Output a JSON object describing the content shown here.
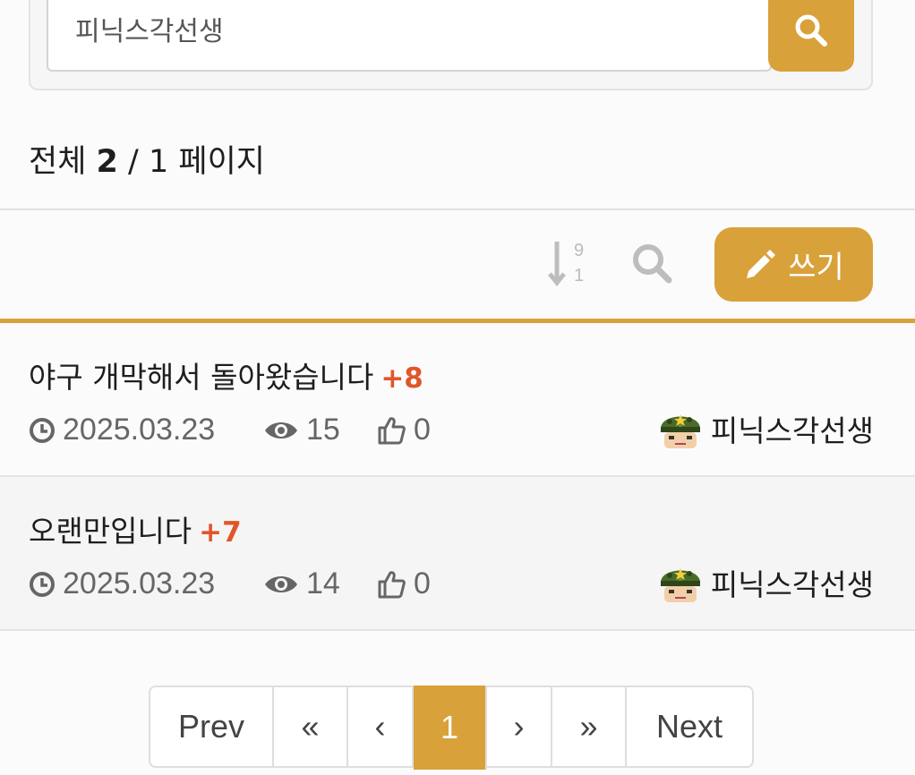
{
  "search": {
    "value": "피닉스각선생"
  },
  "summary": {
    "prefix": "전체",
    "count": "2",
    "sep": "/",
    "pages": "1",
    "suffix": "페이지"
  },
  "toolbar": {
    "write_label": "쓰기"
  },
  "posts": [
    {
      "title": "야구 개막해서 돌아왔습니다",
      "comments": "+8",
      "date": "2025.03.23",
      "views": "15",
      "likes": "0",
      "author": "피닉스각선생"
    },
    {
      "title": "오랜만입니다",
      "comments": "+7",
      "date": "2025.03.23",
      "views": "14",
      "likes": "0",
      "author": "피닉스각선생"
    }
  ],
  "pagination": {
    "prev": "Prev",
    "first": "«",
    "back": "‹",
    "current": "1",
    "fwd": "›",
    "last": "»",
    "next": "Next"
  },
  "colors": {
    "accent": "#d9a13a",
    "comment_count": "#e0562a"
  }
}
